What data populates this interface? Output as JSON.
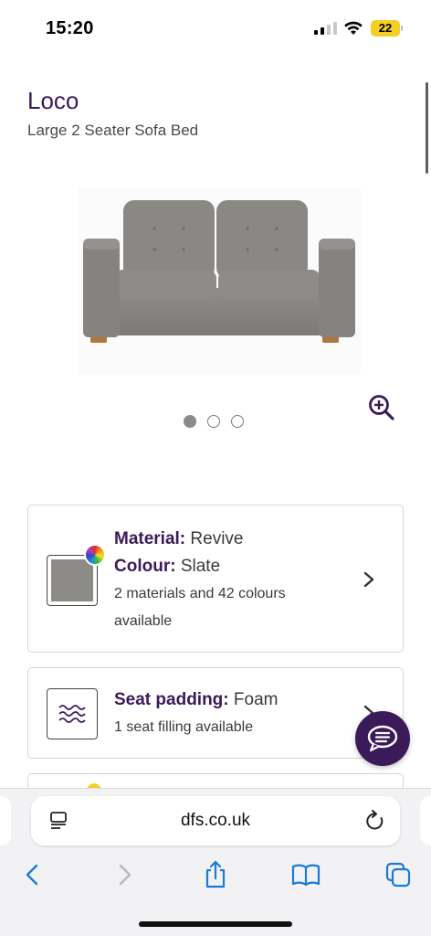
{
  "status_bar": {
    "time": "15:20",
    "battery": "22"
  },
  "product": {
    "name": "Loco",
    "subtitle": "Large 2 Seater Sofa Bed"
  },
  "carousel": {
    "slide_count": 3,
    "active_index": 0
  },
  "material_card": {
    "material_label": "Material:",
    "material_value": "Revive",
    "colour_label": "Colour:",
    "colour_value": "Slate",
    "availability_line1": "2 materials and 42 colours",
    "availability_line2": "available",
    "swatch_color": "#8d8b88"
  },
  "padding_card": {
    "label": "Seat padding:",
    "value": "Foam",
    "availability": "1 seat filling available"
  },
  "browser": {
    "url": "dfs.co.uk"
  },
  "icons": {
    "zoom": "zoom-in-icon",
    "chevron": "chevron-right-icon",
    "chat": "chat-icon",
    "reader": "reader-mode-icon",
    "reload": "reload-icon",
    "back": "back-arrow-icon",
    "forward": "forward-arrow-icon",
    "share": "share-icon",
    "bookmarks": "bookmarks-icon",
    "tabs": "tabs-icon"
  },
  "colors": {
    "brand_purple": "#3b1a5a",
    "ios_blue": "#1a7bd6",
    "battery_yellow": "#f5cf25"
  }
}
